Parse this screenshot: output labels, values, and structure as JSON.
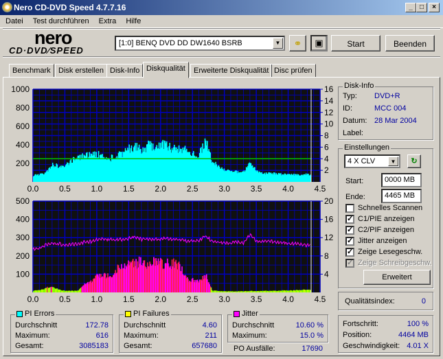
{
  "window": {
    "title": "Nero CD-DVD Speed 4.7.7.16",
    "minimize": "_",
    "maximize": "□",
    "close": "×"
  },
  "menu": [
    "Datei",
    "Test durchführen",
    "Extra",
    "Hilfe"
  ],
  "logo": {
    "top": "nero",
    "bottom": "CD·DVD⁄SPEED"
  },
  "toolbar": {
    "drive": "[1:0]   BENQ DVD DD DW1640 BSRB",
    "start": "Start",
    "exit": "Beenden"
  },
  "tabs": [
    "Benchmark",
    "Disk erstellen",
    "Disk-Info",
    "Diskqualität",
    "Erweiterte Diskqualität",
    "Disc prüfen"
  ],
  "disk_info": {
    "title": "Disk-Info",
    "type_label": "Typ:",
    "type": "DVD+R",
    "id_label": "ID:",
    "id": "MCC 004",
    "date_label": "Datum:",
    "date": "28 Mar 2004",
    "label_label": "Label:"
  },
  "settings": {
    "title": "Einstellungen",
    "speed": "4 X CLV",
    "start_label": "Start:",
    "start": "0000 MB",
    "end_label": "Ende:",
    "end": "4465 MB",
    "checks": [
      {
        "label": "Schnelles Scannen",
        "checked": false,
        "disabled": false
      },
      {
        "label": "C1/PIE anzeigen",
        "checked": true,
        "disabled": false
      },
      {
        "label": "C2/PIF anzeigen",
        "checked": true,
        "disabled": false
      },
      {
        "label": "Jitter anzeigen",
        "checked": true,
        "disabled": false
      },
      {
        "label": "Zeige Lesegeschw.",
        "checked": true,
        "disabled": false
      },
      {
        "label": "Zeige Schreibgeschw.",
        "checked": true,
        "disabled": true
      }
    ],
    "advanced": "Erweitert"
  },
  "quality": {
    "label": "Qualitätsindex:",
    "value": "0"
  },
  "progress": {
    "progress_label": "Fortschritt:",
    "progress": "100 %",
    "position_label": "Position:",
    "position": "4464 MB",
    "speed_label": "Geschwindigkeit:",
    "speed": "4.01 X"
  },
  "pi_errors": {
    "title": "PI Errors",
    "color": "#00ffff",
    "avg_label": "Durchschnitt",
    "avg": "172.78",
    "max_label": "Maximum:",
    "max": "616",
    "total_label": "Gesamt:",
    "total": "3085183"
  },
  "pi_failures": {
    "title": "PI Failures",
    "color": "#ffff00",
    "avg_label": "Durchschnitt",
    "avg": "4.60",
    "max_label": "Maximum:",
    "max": "211",
    "total_label": "Gesamt:",
    "total": "657680"
  },
  "jitter": {
    "title": "Jitter",
    "color": "#ff00ff",
    "avg_label": "Durchschnitt",
    "avg": "10.60 %",
    "max_label": "Maximum:",
    "max": "15.0 %",
    "po_label": "PO Ausfälle:",
    "po": "17690"
  },
  "chart_data": [
    {
      "type": "bar",
      "name": "PI Errors",
      "x_ticks": [
        "0.0",
        "0.5",
        "1.0",
        "1.5",
        "2.0",
        "2.5",
        "3.0",
        "3.5",
        "4.0",
        "4.5"
      ],
      "xlim": [
        0,
        4.5
      ],
      "ylim": [
        0,
        1000
      ],
      "y_ticks": [
        "200",
        "400",
        "600",
        "800",
        "1000"
      ],
      "y2lim": [
        0,
        16
      ],
      "y2_ticks": [
        "2",
        "4",
        "6",
        "8",
        "10",
        "12",
        "14",
        "16"
      ],
      "x_step": 0.1,
      "pie": [
        70,
        80,
        100,
        180,
        170,
        180,
        230,
        260,
        290,
        280,
        300,
        280,
        250,
        280,
        300,
        360,
        380,
        350,
        390,
        380,
        400,
        400,
        350,
        360,
        340,
        300,
        290,
        460,
        230,
        160,
        130,
        110,
        110,
        110,
        200,
        120,
        90,
        90,
        90,
        80,
        80,
        80,
        80,
        80
      ],
      "read_speed": 4.0,
      "end_gb": 4.36
    },
    {
      "type": "bar",
      "name": "PI Failures / Jitter",
      "x_ticks": [
        "0.0",
        "0.5",
        "1.0",
        "1.5",
        "2.0",
        "2.5",
        "3.0",
        "3.5",
        "4.0",
        "4.5"
      ],
      "xlim": [
        0,
        4.5
      ],
      "ylim": [
        0,
        500
      ],
      "y_ticks": [
        "100",
        "200",
        "300",
        "400",
        "500"
      ],
      "y2lim": [
        0,
        20
      ],
      "y2_ticks": [
        "4",
        "8",
        "12",
        "16",
        "20"
      ],
      "x_step": 0.1,
      "pif": [
        10,
        12,
        25,
        30,
        15,
        8,
        8,
        10,
        45,
        55,
        90,
        90,
        90,
        130,
        130,
        160,
        160,
        170,
        150,
        165,
        160,
        160,
        155,
        140,
        70,
        70,
        60,
        100,
        10,
        8,
        6,
        6,
        6,
        6,
        8,
        8,
        8,
        8,
        8,
        10,
        10,
        12,
        14,
        14
      ],
      "jitter": [
        9.5,
        9.6,
        10.4,
        10.8,
        10.7,
        10.3,
        10.5,
        10.7,
        11.0,
        11.1,
        11.6,
        11.7,
        11.6,
        11.5,
        11.6,
        11.8,
        12.2,
        11.6,
        11.7,
        11.6,
        11.7,
        11.8,
        11.5,
        11.6,
        11.2,
        11.2,
        11.3,
        12.4,
        11.3,
        11.0,
        10.9,
        10.8,
        11.0,
        10.9,
        12.6,
        11.3,
        11.2,
        11.3,
        11.0,
        10.9,
        10.8,
        10.7,
        10.5,
        10.3
      ]
    }
  ]
}
